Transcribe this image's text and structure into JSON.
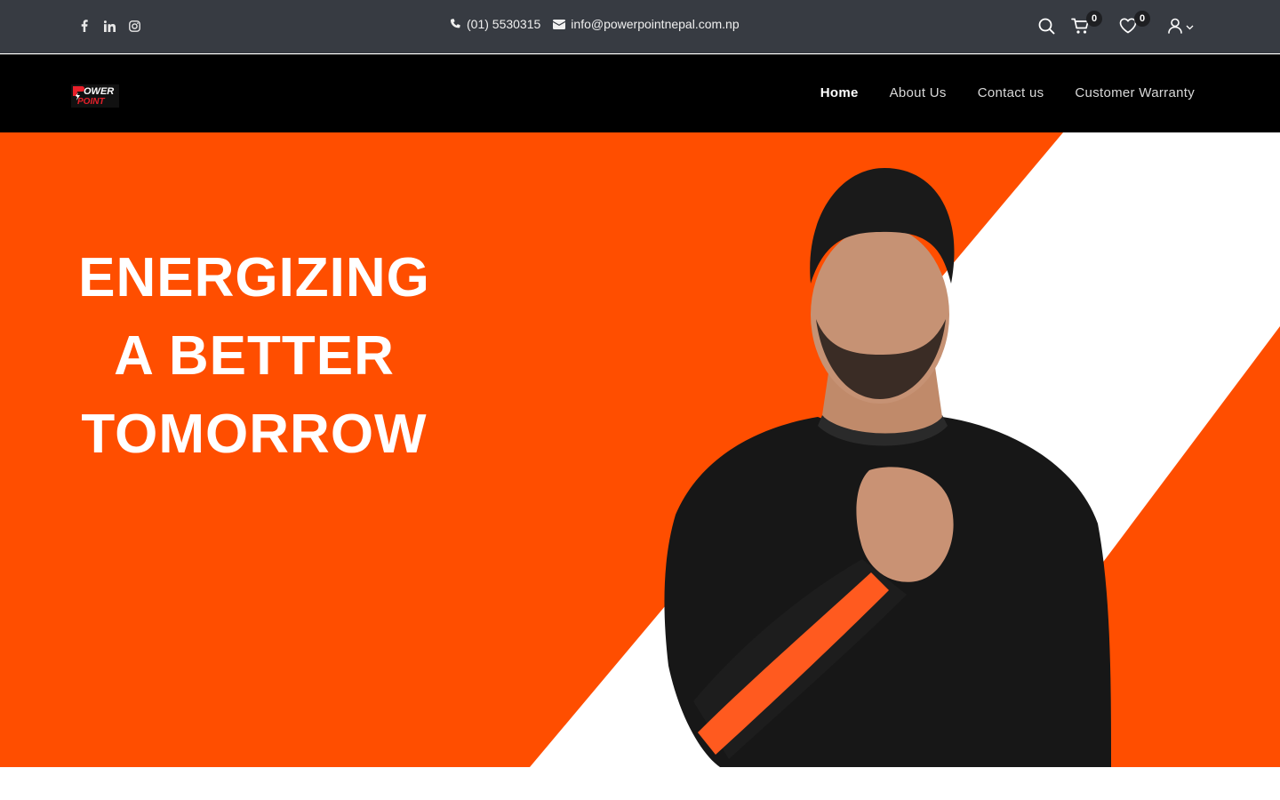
{
  "topbar": {
    "social": [
      {
        "icon": "facebook-icon"
      },
      {
        "icon": "linkedin-icon"
      },
      {
        "icon": "instagram-icon"
      }
    ],
    "phone": "(01) 5530315",
    "email": "info@powerpointnepal.com.np",
    "cart_count": "0",
    "wishlist_count": "0"
  },
  "nav": {
    "logo_text": [
      "POWER",
      "POINT"
    ],
    "items": [
      {
        "label": "Home",
        "active": true
      },
      {
        "label": "About Us"
      },
      {
        "label": "Contact us"
      },
      {
        "label": "Customer Warranty"
      }
    ]
  },
  "hero": {
    "lines": [
      "ENERGIZING",
      "A BETTER",
      "TOMORROW"
    ],
    "colors": {
      "orange": "#ff4e00",
      "white": "#ffffff",
      "shirt": "#151515",
      "stripe": "#ff5a1f"
    }
  }
}
